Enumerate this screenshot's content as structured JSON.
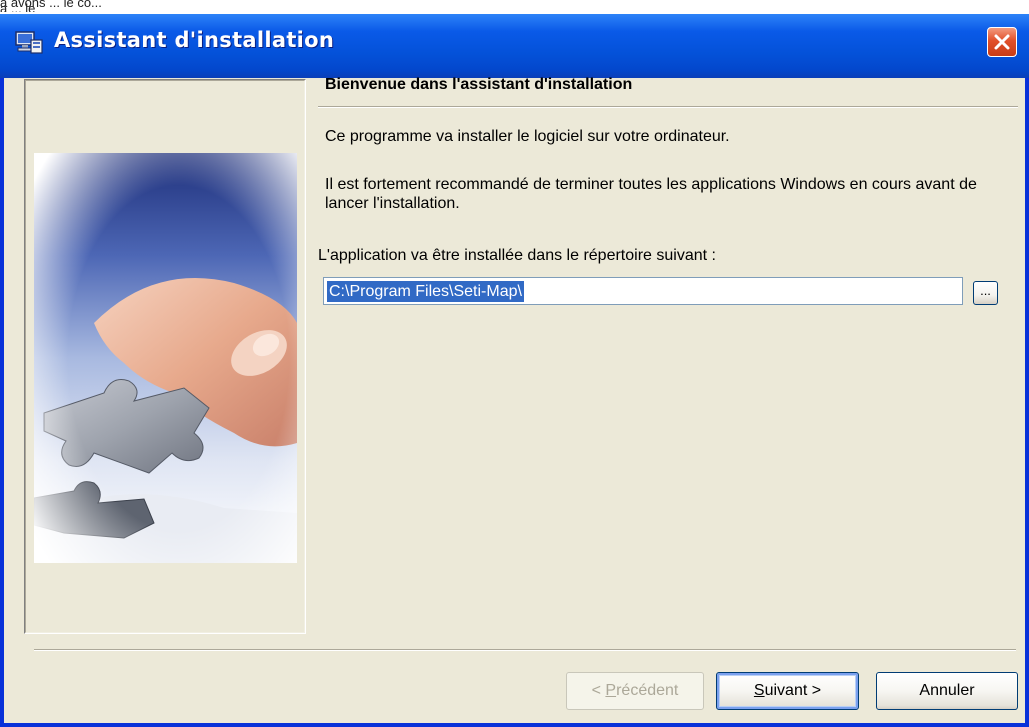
{
  "window": {
    "title": "Assistant d'installation",
    "top_fragment": "a avons ... le co... a ... le"
  },
  "page": {
    "heading": "Bienvenue dans l'assistant d'installation",
    "intro": "Ce programme va installer le logiciel sur votre ordinateur.",
    "recommendation": "Il est fortement recommandé de terminer toutes les applications Windows en cours avant de lancer l'installation.",
    "directory_label": "L'application va être installée dans le répertoire suivant :",
    "directory_value": "C:\\Program Files\\Seti-Map\\",
    "browse_label": "..."
  },
  "buttons": {
    "previous_prefix": "< ",
    "previous_accel": "P",
    "previous_rest": "récédent",
    "next_accel": "S",
    "next_rest": "uivant >",
    "cancel": "Annuler"
  },
  "colors": {
    "titlebar": "#0a5ae8",
    "selection": "#316ac5",
    "dialog_bg": "#ece9d8"
  },
  "icons": {
    "title_icon": "installer-computer-icon",
    "close": "close-icon",
    "banner": "puzzle-hand-image"
  }
}
